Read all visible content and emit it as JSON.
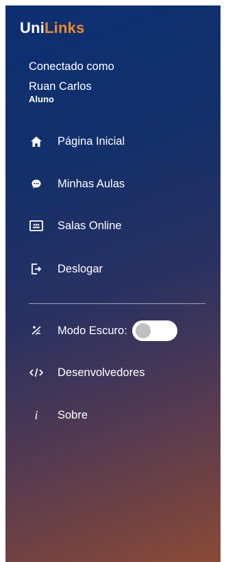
{
  "brand": {
    "part1": "Uni",
    "part2": "Links"
  },
  "user": {
    "status": "Conectado como",
    "name": "Ruan Carlos",
    "role": "Aluno"
  },
  "nav": [
    {
      "label": "Página Inicial",
      "icon": "home-icon"
    },
    {
      "label": "Minhas Aulas",
      "icon": "chat-bubble-icon"
    },
    {
      "label": "Salas Online",
      "icon": "classroom-board-icon"
    },
    {
      "label": "Deslogar",
      "icon": "logout-icon"
    }
  ],
  "settings": {
    "dark_mode_label": "Modo Escuro:",
    "dark_mode_enabled": false,
    "developers_label": "Desenvolvedores",
    "about_label": "Sobre",
    "about_icon_text": "i"
  },
  "colors": {
    "brand_accent": "#f48a2a",
    "gradient_top": "#0c2f72",
    "gradient_bottom": "#8a4a35"
  }
}
